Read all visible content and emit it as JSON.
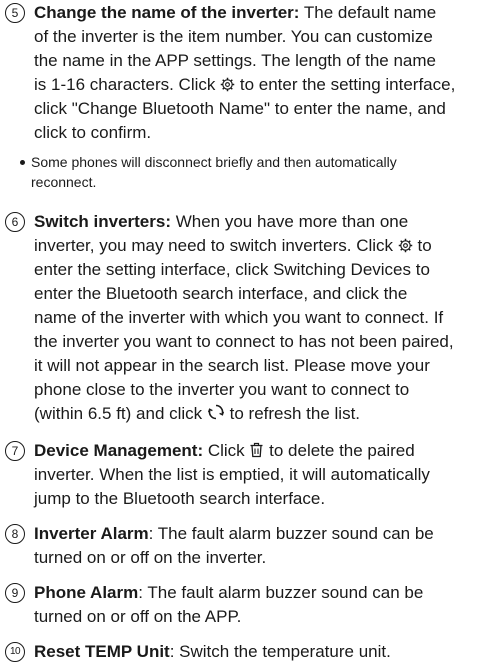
{
  "items": [
    {
      "number": "5",
      "title": "Change the name of the inverter:",
      "line1_rest": " The default name",
      "lines": [
        "of the inverter is the item number. You can customize",
        "the name in the APP settings. The length of the name",
        "is 1-16 characters. Click",
        " to enter the setting interface,",
        "click \"Change Bluetooth Name\" to enter the name, and",
        "click to confirm."
      ],
      "icon": "gear-icon"
    },
    {
      "note": [
        "Some phones will disconnect briefly and then automatically",
        "reconnect."
      ]
    },
    {
      "number": "6",
      "title": "Switch inverters:",
      "line1_rest": " When you have more than one",
      "lines": [
        "inverter, you may need to switch inverters. Click",
        " to",
        "enter the setting interface, click Switching Devices to",
        "enter the Bluetooth search interface, and click the",
        "name of the inverter with which you want to connect. If",
        "the inverter you want to connect to has not been paired,",
        "it will not appear in the search list. Please move your",
        "phone close to the inverter you want to connect to",
        "(within 6.5 ft) and click",
        " to refresh the list."
      ],
      "icons": [
        "gear-icon",
        "refresh-icon"
      ]
    },
    {
      "number": "7",
      "title": "Device Management:",
      "line1_pre": " Click ",
      "line1_rest": " to delete the paired",
      "lines": [
        "inverter. When the list is emptied, it will automatically",
        "jump to the Bluetooth search interface."
      ],
      "icon": "trash-icon"
    },
    {
      "number": "8",
      "title": "Inverter Alarm",
      "line1_rest": ": The fault alarm buzzer sound can be",
      "lines": [
        "turned on or off on the inverter."
      ]
    },
    {
      "number": "9",
      "title": "Phone Alarm",
      "line1_rest": ": The fault alarm buzzer sound can be",
      "lines": [
        "turned on or off on the APP."
      ]
    },
    {
      "number": "10",
      "title": "Reset TEMP Unit",
      "line1_rest": ": Switch the temperature unit."
    }
  ]
}
